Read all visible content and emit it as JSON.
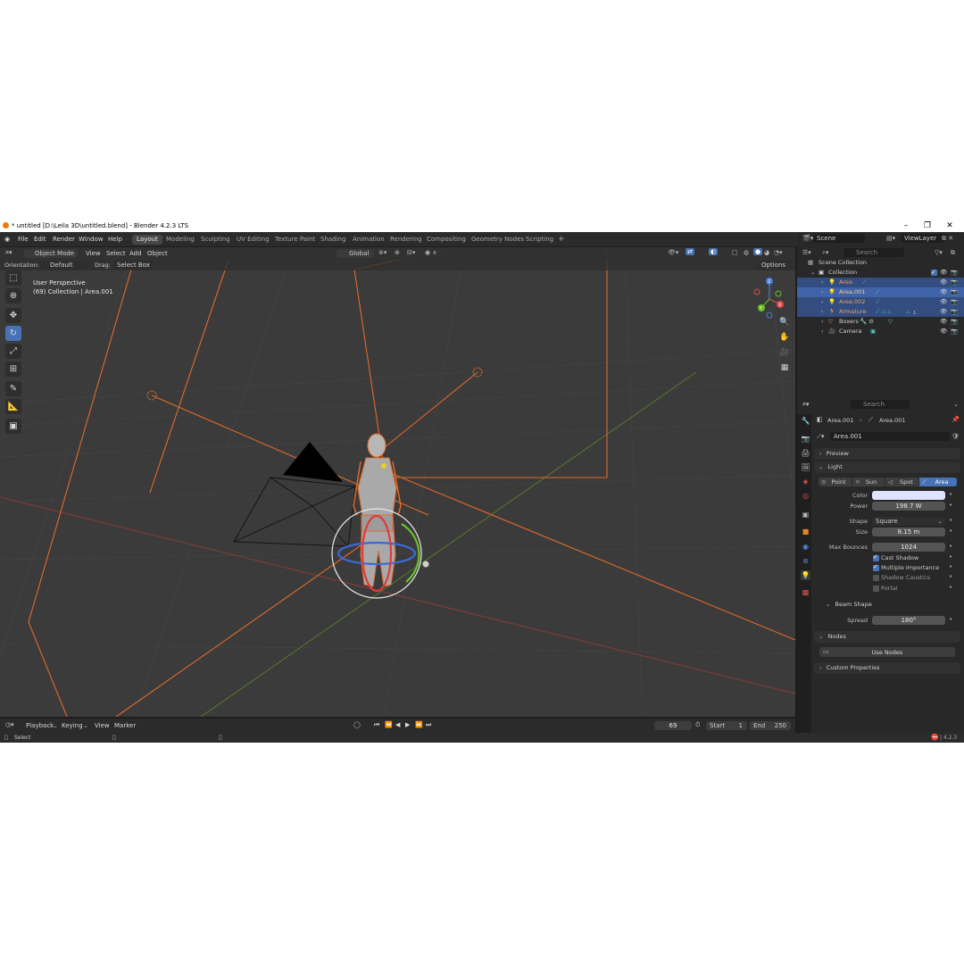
{
  "window": {
    "title": "* untitled [D:\\Leila 3D\\untitled.blend] - Blender 4.2.3 LTS"
  },
  "menu": [
    "File",
    "Edit",
    "Render",
    "Window",
    "Help"
  ],
  "workspaces": [
    "Layout",
    "Modeling",
    "Sculpting",
    "UV Editing",
    "Texture Paint",
    "Shading",
    "Animation",
    "Rendering",
    "Compositing",
    "Geometry Nodes",
    "Scripting"
  ],
  "workspace_add": "+",
  "scene": {
    "name": "Scene",
    "view_layer": "ViewLayer"
  },
  "viewport": {
    "mode": "Object Mode",
    "menus": [
      "View",
      "Select",
      "Add",
      "Object"
    ],
    "transform": "Global",
    "orientation_label": "Orientation:",
    "orientation_value": "Default",
    "drag_label": "Drag:",
    "drag_value": "Select Box",
    "options_label": "Options",
    "overlay_title": "User Perspective",
    "overlay_subtitle": "(69) Collection | Area.001",
    "gizmo_x": "X",
    "gizmo_y": "Y",
    "gizmo_z": "Z"
  },
  "outliner": {
    "search_placeholder": "Search",
    "scene_collection": "Scene Collection",
    "collection": "Collection",
    "items": [
      {
        "name": "Area",
        "selected": true,
        "active": false
      },
      {
        "name": "Area.001",
        "selected": true,
        "active": true
      },
      {
        "name": "Area.002",
        "selected": true,
        "active": false
      },
      {
        "name": "Armature",
        "selected": true,
        "active": false
      },
      {
        "name": "Boxers",
        "selected": false,
        "active": false
      },
      {
        "name": "Camera",
        "selected": false,
        "active": false
      }
    ],
    "armature_child_count": "1"
  },
  "properties": {
    "search_placeholder": "Search",
    "breadcrumb_object": "Area.001",
    "breadcrumb_data": "Area.001",
    "datablock_name": "Area.001",
    "panels": {
      "preview": "Preview",
      "light": "Light",
      "beam_shape": "Beam Shape",
      "nodes": "Nodes",
      "custom_properties": "Custom Properties"
    },
    "light_types": [
      "Point",
      "Sun",
      "Spot",
      "Area"
    ],
    "active_light_type": "Area",
    "color_label": "Color",
    "color_value": "#dfe3ff",
    "power_label": "Power",
    "power_value": "198.7 W",
    "shape_label": "Shape",
    "shape_value": "Square",
    "size_label": "Size",
    "size_value": "8.15 m",
    "max_bounces_label": "Max Bounces",
    "max_bounces_value": "1024",
    "checkboxes": [
      {
        "label": "Cast Shadow",
        "checked": true
      },
      {
        "label": "Multiple Importance",
        "checked": true
      },
      {
        "label": "Shadow Caustics",
        "checked": false
      },
      {
        "label": "Portal",
        "checked": false
      }
    ],
    "spread_label": "Spread",
    "spread_value": "180°",
    "use_nodes_label": "Use Nodes"
  },
  "timeline": {
    "menus": [
      "Playback",
      "Keying",
      "View",
      "Marker"
    ],
    "current_frame": "69",
    "start_label": "Start",
    "start_value": "1",
    "end_label": "End",
    "end_value": "250"
  },
  "status": {
    "left": "Select",
    "version": "4.2.3"
  },
  "colors": {
    "accent": "#4772b3",
    "selection": "#e8632a",
    "header": "#2b2b2b",
    "viewport_bg": "#3b3b3b"
  }
}
